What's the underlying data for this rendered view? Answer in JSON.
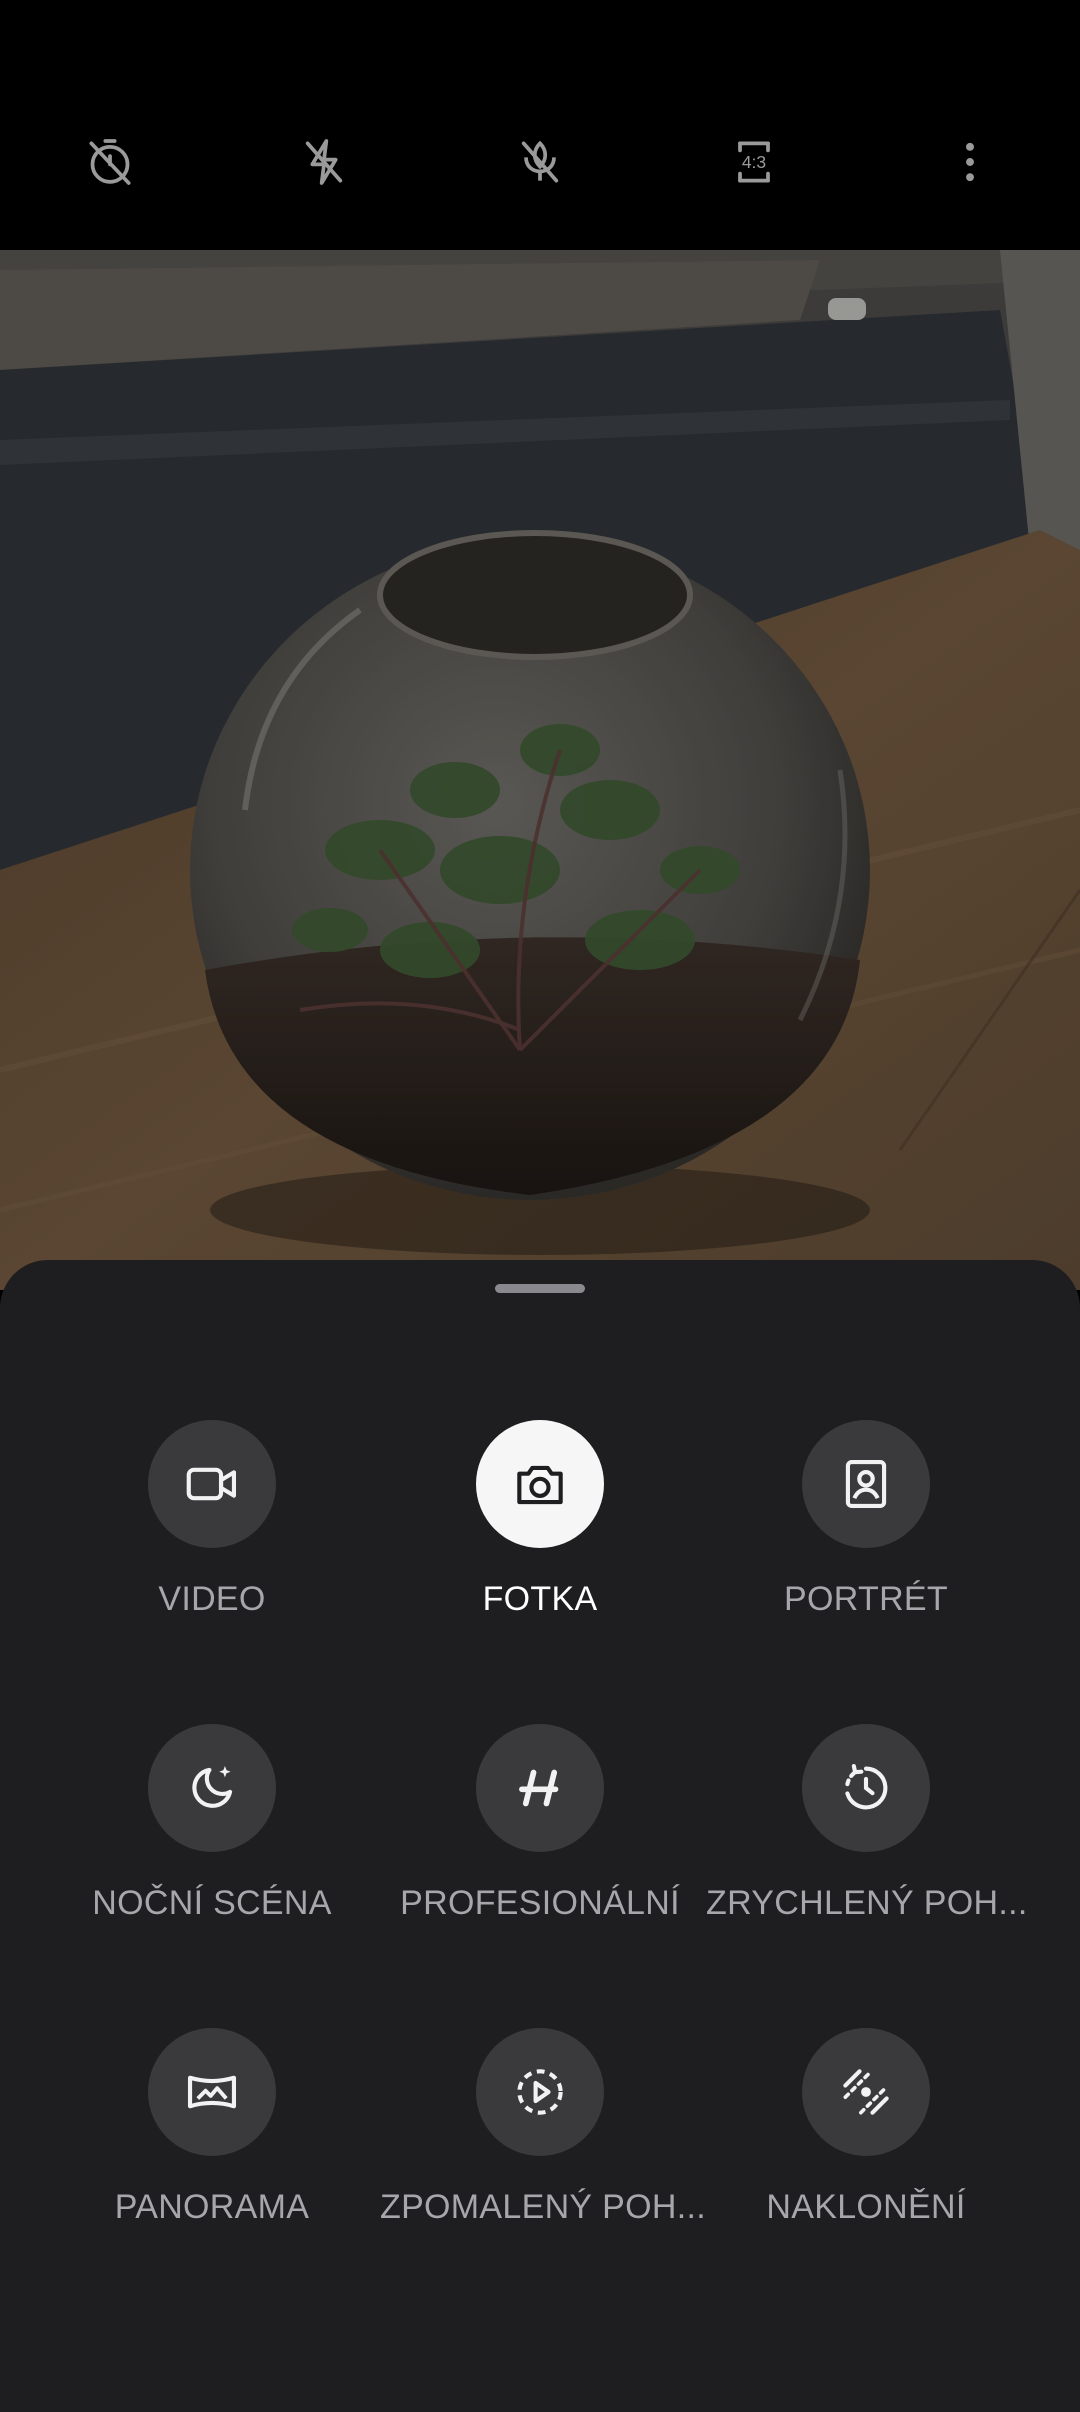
{
  "toolbar": {
    "items": [
      {
        "id": "timer-off",
        "icon": "timer-off-icon"
      },
      {
        "id": "flash-off",
        "icon": "flash-off-icon"
      },
      {
        "id": "ai-scene-off",
        "icon": "ai-scene-off-icon"
      },
      {
        "id": "aspect-ratio",
        "icon": "aspect-ratio-icon",
        "text": "4:3"
      },
      {
        "id": "more",
        "icon": "more-vert-icon"
      }
    ]
  },
  "modes": [
    {
      "label": "VIDEO",
      "icon": "video-icon",
      "selected": false
    },
    {
      "label": "FOTKA",
      "icon": "camera-icon",
      "selected": true
    },
    {
      "label": "PORTRÉT",
      "icon": "portrait-icon",
      "selected": false
    },
    {
      "label": "NOČNÍ SCÉNA",
      "icon": "night-icon",
      "selected": false
    },
    {
      "label": "PROFESIONÁLNÍ",
      "icon": "pro-icon",
      "selected": false
    },
    {
      "label": "ZRYCHLENÝ POH...",
      "icon": "timelapse-icon",
      "selected": false
    },
    {
      "label": "PANORAMA",
      "icon": "panorama-icon",
      "selected": false
    },
    {
      "label": "ZPOMALENÝ POH...",
      "icon": "slow-motion-icon",
      "selected": false
    },
    {
      "label": "NAKLONĚNÍ",
      "icon": "tilt-shift-icon",
      "selected": false
    }
  ],
  "colors": {
    "sheet_bg": "#1e1e21",
    "mode_circle": "#3a3a3d",
    "mode_circle_active": "#f6f6f6",
    "label": "#a7a7ab",
    "label_active": "#ffffff"
  }
}
